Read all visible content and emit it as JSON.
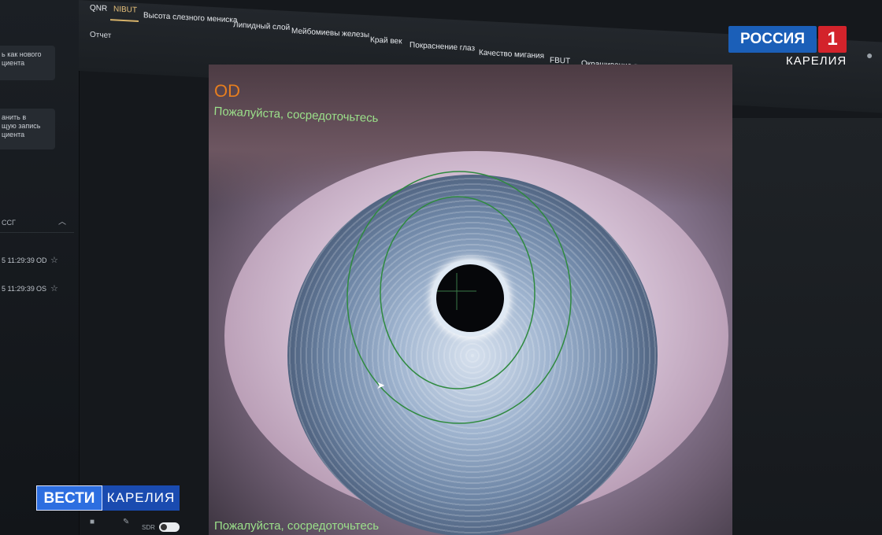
{
  "tabs": {
    "qnr": "QNR",
    "nibut": "NIBUT",
    "meniscus": "Высота слезного мениска",
    "lipid": "Липидный слой",
    "meibomian": "Мейбомиевы железы",
    "lid_margin": "Край век",
    "redness": "Покраснение глаз",
    "blink": "Качество мигания",
    "fbut": "FBUT",
    "staining": "Окрашивание поверхности глаза",
    "report": "Отчет"
  },
  "sidebar": {
    "new_patient_button": "ь как нового\nциента",
    "save_record_button": "анить в\nщую запись\nциента",
    "section_title": "ССГ",
    "records": [
      {
        "time": "5 11:29:39",
        "eye": "OD"
      },
      {
        "time": "5 11:29:39",
        "eye": "OS"
      }
    ]
  },
  "viewer": {
    "eye_label": "OD",
    "message": "Пожалуйста, сосредоточьтесь",
    "message_bottom": "Пожалуйста, сосредоточьтесь"
  },
  "tools": {
    "sdr_label": "SDR"
  },
  "broadcast": {
    "channel_name": "РОССИЯ",
    "channel_number": "1",
    "channel_region": "КАРЕЛИЯ",
    "news_brand": "ВЕСТИ",
    "news_region": "КАРЕЛИЯ"
  },
  "colors": {
    "eye_label": "#e67e1f",
    "message": "#9be08a",
    "active_tab": "#e6c07a",
    "ring": "#2f8a3f"
  },
  "icons": {
    "star": "star-icon",
    "user": "user-icon",
    "camera": "camera-icon",
    "wrench": "wrench-icon"
  }
}
